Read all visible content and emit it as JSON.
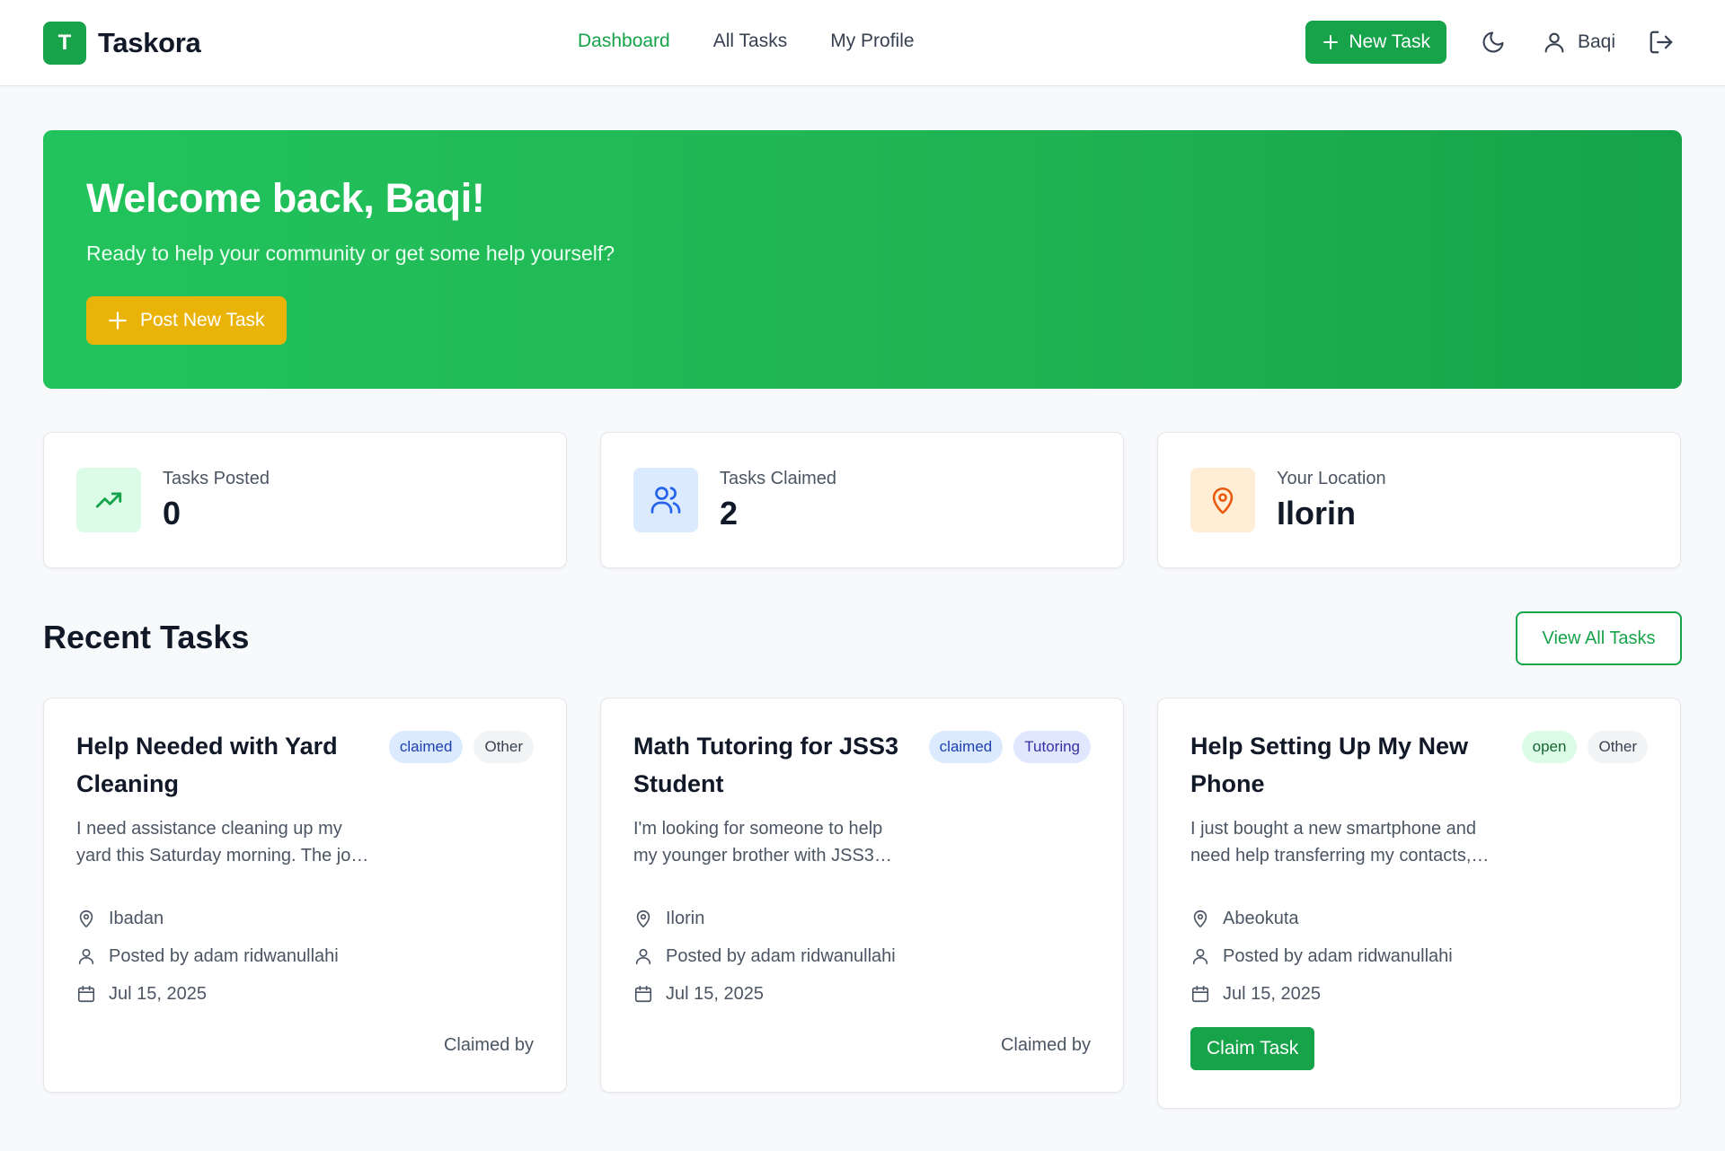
{
  "brand": {
    "letter": "T",
    "name": "Taskora"
  },
  "nav": {
    "links": [
      {
        "label": "Dashboard",
        "active": true
      },
      {
        "label": "All Tasks",
        "active": false
      },
      {
        "label": "My Profile",
        "active": false
      }
    ],
    "new_task_label": "New Task",
    "user_name": "Baqi",
    "icons": {
      "plus": "plus-icon",
      "theme": "moon-icon",
      "user": "user-icon",
      "logout": "logout-icon"
    }
  },
  "hero": {
    "title": "Welcome back, Baqi!",
    "subtitle": "Ready to help your community or get some help yourself?",
    "button_label": "Post New Task"
  },
  "stats": [
    {
      "label": "Tasks Posted",
      "value": "0",
      "icon": "trending-up-icon",
      "color": "#16a34a"
    },
    {
      "label": "Tasks Claimed",
      "value": "2",
      "icon": "users-icon",
      "color": "#2563eb"
    },
    {
      "label": "Your Location",
      "value": "Ilorin",
      "icon": "map-pin-icon",
      "color": "#ea580c"
    }
  ],
  "recent": {
    "title": "Recent Tasks",
    "view_all_label": "View All Tasks",
    "tasks": [
      {
        "title": "Help Needed with Yard Cleaning",
        "status": "claimed",
        "category": "Other",
        "desc_line1": "I need assistance cleaning up my",
        "desc_line2": "yard this Saturday morning. The jo…",
        "location": "Ibadan",
        "posted_by": "Posted by adam ridwanullahi",
        "date": "Jul 15, 2025",
        "footer": "Claimed by"
      },
      {
        "title": "Math Tutoring for JSS3 Student",
        "status": "claimed",
        "category": "Tutoring",
        "desc_line1": "I'm looking for someone to help",
        "desc_line2": "my younger brother with JSS3…",
        "location": "Ilorin",
        "posted_by": "Posted by adam ridwanullahi",
        "date": "Jul 15, 2025",
        "footer": "Claimed by"
      },
      {
        "title": "Help Setting Up My New Phone",
        "status": "open",
        "category": "Other",
        "desc_line1": "I just bought a new smartphone and",
        "desc_line2": "need help transferring my contacts,…",
        "location": "Abeokuta",
        "posted_by": "Posted by adam ridwanullahi",
        "date": "Jul 15, 2025",
        "action_label": "Claim Task"
      }
    ]
  },
  "colors": {
    "brand": "#16a34a",
    "accent": "#eab308",
    "background": "#f8f9fb"
  }
}
